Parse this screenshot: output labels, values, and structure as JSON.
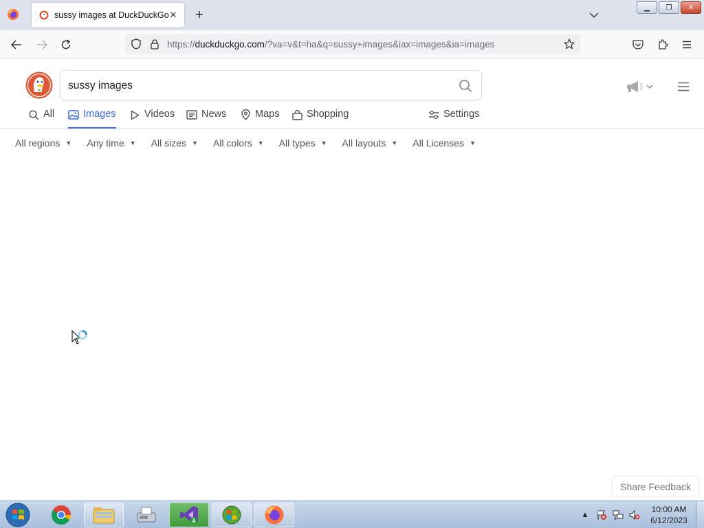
{
  "browser": {
    "tab": {
      "title": "sussy images at DuckDuckGo"
    },
    "url": {
      "prefix": "https://",
      "domain": "duckduckgo.com",
      "path": "/?va=v&t=ha&q=sussy+images&iax=images&ia=images"
    }
  },
  "search": {
    "query": "sussy images",
    "tabs": [
      {
        "label": "All",
        "icon": "search-icon"
      },
      {
        "label": "Images",
        "icon": "image-icon",
        "active": true
      },
      {
        "label": "Videos",
        "icon": "play-icon"
      },
      {
        "label": "News",
        "icon": "newspaper-icon"
      },
      {
        "label": "Maps",
        "icon": "map-pin-icon"
      },
      {
        "label": "Shopping",
        "icon": "shopping-bag-icon"
      }
    ],
    "settings_label": "Settings",
    "filters": [
      "All regions",
      "Any time",
      "All sizes",
      "All colors",
      "All types",
      "All layouts",
      "All Licenses"
    ],
    "feedback_label": "Share Feedback"
  },
  "taskbar": {
    "apps": [
      "chrome-icon",
      "file-explorer-icon",
      "fax-icon",
      "visual-studio-installer-icon",
      "windows-update-icon",
      "firefox-icon"
    ],
    "clock": {
      "time": "10:00 AM",
      "date": "6/12/2023"
    }
  },
  "colors": {
    "accent": "#3969ef",
    "ddg_orange": "#de5833",
    "tabstrip": "#dde2ec",
    "taskbar": "#b9cde6"
  }
}
